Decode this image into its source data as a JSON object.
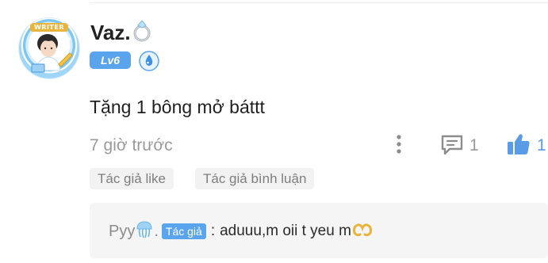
{
  "comment": {
    "username": "Vaz.",
    "level_badge": "Lv6",
    "avatar_ribbon": "WRITER",
    "text": "Tặng 1 bông mở báttt",
    "timestamp": "7 giờ trước",
    "reply_count": "1",
    "like_count": "1",
    "tags": [
      "Tác giả like",
      "Tác giả bình luận"
    ],
    "icons": {
      "name_decoration": "ring-icon",
      "rank": "water-drop-badge-icon",
      "more": "more-vertical-icon",
      "reply": "comment-icon",
      "like": "thumbs-up-icon"
    },
    "colors": {
      "accent": "#5aa4ee",
      "muted_text": "#9a9a9a",
      "tag_bg": "#f2f2f2"
    }
  },
  "reply": {
    "author": "Pyy",
    "author_suffix": ".",
    "author_badge": "Tác giả",
    "separator": ":",
    "text": "aduuu,m oii t yeu m",
    "icons": {
      "author_emoji": "jellyfish-icon",
      "trailing_emoji": "heart-hands-icon"
    }
  }
}
